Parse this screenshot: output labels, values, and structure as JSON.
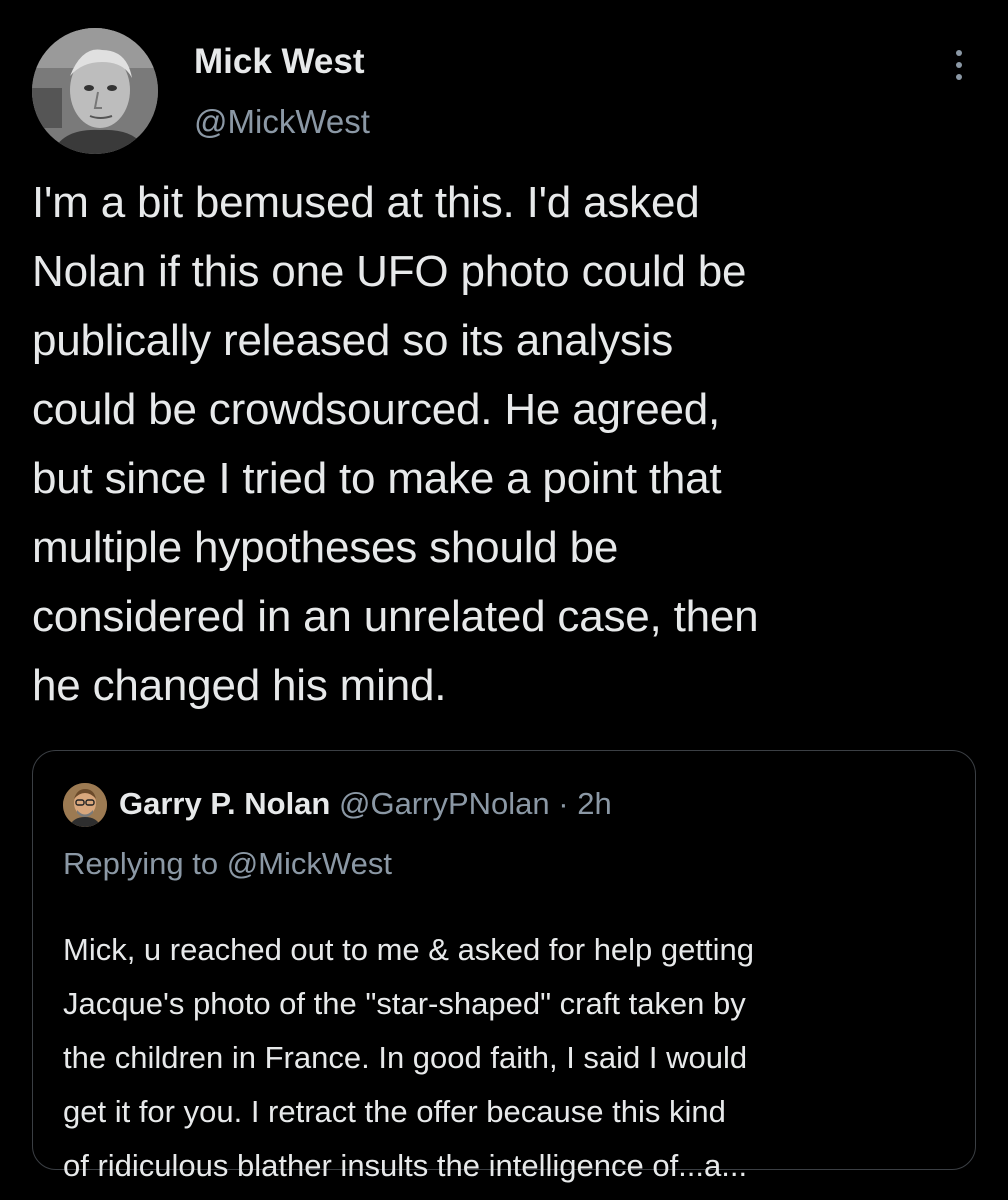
{
  "tweet": {
    "author_name": "Mick West",
    "author_handle": "@MickWest",
    "avatar_icon": "user-avatar-photo",
    "more_icon": "more-options-icon",
    "body": "I'm a bit bemused at this. I'd asked\nNolan if this one UFO photo could be\npublically released so its analysis\ncould be crowdsourced. He agreed,\nbut since I tried to make a point that\nmultiple hypotheses should be\nconsidered in an unrelated case, then\nhe changed his mind."
  },
  "quoted_tweet": {
    "author_name": "Garry P. Nolan",
    "author_handle": "@GarryPNolan",
    "separator": "·",
    "time": "2h",
    "replying_to": "Replying to @MickWest",
    "body": "Mick, u reached out to me & asked for help getting\nJacque's photo of the \"star-shaped\" craft taken by\nthe children in France. In good faith, I said I would\nget it for you. I retract the offer because this kind\nof ridiculous blather insults the intelligence of...a..."
  },
  "colors": {
    "background": "#000000",
    "primary_text": "#e7e9ea",
    "secondary_text": "#8b98a5",
    "border": "#3b3f44"
  }
}
